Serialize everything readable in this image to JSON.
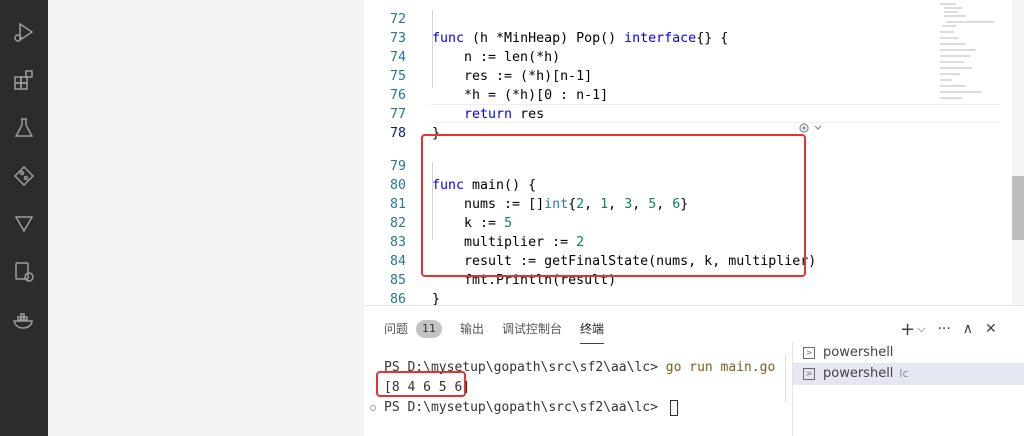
{
  "editor": {
    "lines": [
      {
        "num": "72",
        "text": "func (h *MinHeap) Pop() interface{} {"
      },
      {
        "num": "73",
        "text": "    n := len(*h)"
      },
      {
        "num": "74",
        "text": "    res := (*h)[n-1]"
      },
      {
        "num": "75",
        "text": "    *h = (*h)[0 : n-1]"
      },
      {
        "num": "76",
        "text": "    return res"
      },
      {
        "num": "77",
        "text": "}"
      },
      {
        "num": "78",
        "text": ""
      },
      {
        "num": "79",
        "text": "func main() {"
      },
      {
        "num": "80",
        "text": "    nums := []int{2, 1, 3, 5, 6}"
      },
      {
        "num": "81",
        "text": "    k := 5"
      },
      {
        "num": "82",
        "text": "    multiplier := 2"
      },
      {
        "num": "83",
        "text": "    result := getFinalState(nums, k, multiplier)"
      },
      {
        "num": "84",
        "text": "    fmt.Println(result)"
      },
      {
        "num": "85",
        "text": "}"
      },
      {
        "num": "86",
        "text": ""
      }
    ]
  },
  "panel": {
    "tabs": {
      "problems": "问题",
      "problems_count": "11",
      "output": "输出",
      "debug_console": "调试控制台",
      "terminal": "终端"
    },
    "actions": {
      "add": "+",
      "dropdown": "⌵",
      "more": "···",
      "maximize": "∧",
      "close": "✕"
    }
  },
  "terminal": {
    "prompt1": "PS D:\\mysetup\\gopath\\src\\sf2\\aa\\lc> ",
    "command1": "go run main.go",
    "output": "[8 4 6 5 6]",
    "prompt2": "PS D:\\mysetup\\gopath\\src\\sf2\\aa\\lc> "
  },
  "terminal_list": [
    {
      "label": "powershell",
      "tag": ""
    },
    {
      "label": "powershell",
      "tag": "lc"
    }
  ],
  "colors": {
    "highlight": "#e3342f",
    "activity_bar": "#2c2c2c",
    "keyword": "#0000ff",
    "number": "#098658"
  }
}
